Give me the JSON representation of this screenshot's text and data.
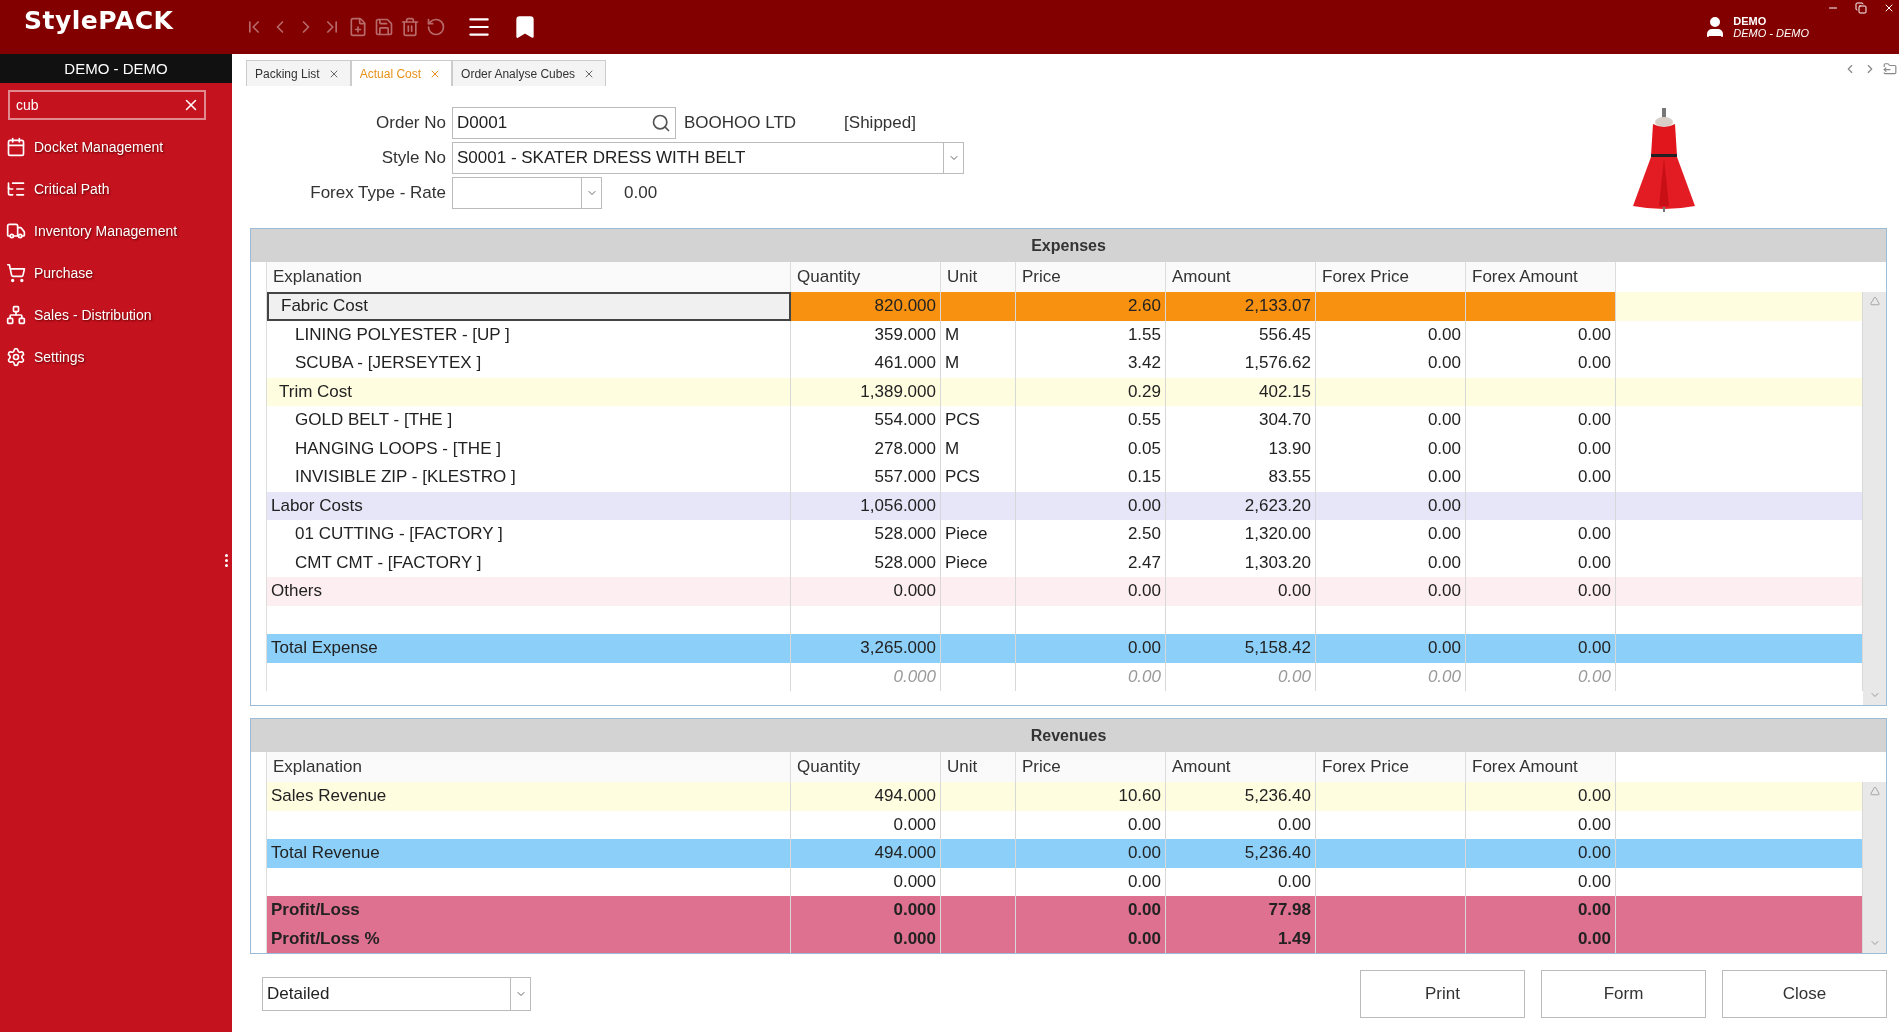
{
  "app": {
    "logo": "StylePACK",
    "user": {
      "name": "DEMO",
      "company": "DEMO - DEMO"
    }
  },
  "sidebar": {
    "title": "DEMO - DEMO",
    "search": {
      "value": "cub"
    },
    "items": [
      {
        "label": "Docket Management"
      },
      {
        "label": "Critical Path"
      },
      {
        "label": "Inventory Management"
      },
      {
        "label": "Purchase"
      },
      {
        "label": "Sales - Distribution"
      },
      {
        "label": "Settings"
      }
    ]
  },
  "tabs": [
    {
      "label": "Packing List",
      "selected": false
    },
    {
      "label": "Actual Cost",
      "selected": true
    },
    {
      "label": "Order Analyse Cubes",
      "selected": false
    }
  ],
  "form": {
    "order_no": {
      "label": "Order No",
      "value": "D0001",
      "customer": "BOOHOO LTD",
      "status": "[Shipped]"
    },
    "style_no": {
      "label": "Style No",
      "value": "S0001 - SKATER DRESS WITH BELT"
    },
    "forex": {
      "label": "Forex Type - Rate",
      "rate": "0.00"
    }
  },
  "expenses": {
    "title": "Expenses",
    "columns": [
      "Explanation",
      "Quantity",
      "Unit",
      "Price",
      "Amount",
      "Forex Price",
      "Forex Amount"
    ],
    "rows": [
      {
        "kind": "group",
        "selected": true,
        "color": "#fffde0",
        "explanation": "Fabric Cost",
        "quantity": "820.000",
        "price": "2.60",
        "amount": "2,133.07",
        "children": [
          {
            "kind": "item",
            "explanation": "LINING POLYESTER - [UP ]",
            "quantity": "359.000",
            "unit": "M",
            "price": "1.55",
            "amount": "556.45",
            "forex_price": "0.00",
            "forex_amount": "0.00"
          },
          {
            "kind": "item",
            "explanation": "SCUBA - [JERSEYTEX ]",
            "quantity": "461.000",
            "unit": "M",
            "price": "3.42",
            "amount": "1,576.62",
            "forex_price": "0.00",
            "forex_amount": "0.00"
          }
        ]
      },
      {
        "kind": "group",
        "selected": false,
        "color": "#fffde0",
        "explanation": "Trim Cost",
        "quantity": "1,389.000",
        "price": "0.29",
        "amount": "402.15",
        "children": [
          {
            "kind": "item",
            "explanation": "GOLD BELT - [THE ]",
            "quantity": "554.000",
            "unit": "PCS",
            "price": "0.55",
            "amount": "304.70",
            "forex_price": "0.00",
            "forex_amount": "0.00"
          },
          {
            "kind": "item",
            "explanation": "HANGING LOOPS - [THE ]",
            "quantity": "278.000",
            "unit": "M",
            "price": "0.05",
            "amount": "13.90",
            "forex_price": "0.00",
            "forex_amount": "0.00"
          },
          {
            "kind": "item",
            "explanation": "INVISIBLE ZIP - [KLESTRO ]",
            "quantity": "557.000",
            "unit": "PCS",
            "price": "0.15",
            "amount": "83.55",
            "forex_price": "0.00",
            "forex_amount": "0.00"
          }
        ]
      },
      {
        "kind": "category",
        "selected": false,
        "color": "#e6e6f8",
        "explanation": "Labor Costs",
        "quantity": "1,056.000",
        "price": "0.00",
        "amount": "2,623.20",
        "forex_price": "0.00",
        "children": [
          {
            "kind": "item",
            "explanation": "01  CUTTING - [FACTORY ]",
            "quantity": "528.000",
            "unit": "Piece",
            "price": "2.50",
            "amount": "1,320.00",
            "forex_price": "0.00",
            "forex_amount": "0.00"
          },
          {
            "kind": "item",
            "explanation": "CMT  CMT - [FACTORY ]",
            "quantity": "528.000",
            "unit": "Piece",
            "price": "2.47",
            "amount": "1,303.20",
            "forex_price": "0.00",
            "forex_amount": "0.00"
          }
        ]
      },
      {
        "kind": "category",
        "selected": false,
        "color": "#fdeef2",
        "explanation": "Others",
        "quantity": "0.000",
        "price": "0.00",
        "amount": "0.00",
        "forex_price": "0.00",
        "forex_amount": "0.00"
      },
      {
        "kind": "blank",
        "selected": false
      },
      {
        "kind": "total",
        "selected": false,
        "color": "#8ccff8",
        "explanation": "Total Expense",
        "quantity": "3,265.000",
        "price": "0.00",
        "amount": "5,158.42",
        "forex_price": "0.00",
        "forex_amount": "0.00"
      },
      {
        "kind": "hint",
        "selected": false,
        "quantity": "0.000",
        "price": "0.00",
        "amount": "0.00",
        "forex_price": "0.00",
        "forex_amount": "0.00"
      }
    ]
  },
  "revenues": {
    "title": "Revenues",
    "columns": [
      "Explanation",
      "Quantity",
      "Unit",
      "Price",
      "Amount",
      "Forex Price",
      "Forex Amount"
    ],
    "rows": [
      {
        "kind": "category",
        "selected": false,
        "color": "#fffde0",
        "explanation": "Sales Revenue",
        "quantity": "494.000",
        "price": "10.60",
        "amount": "5,236.40",
        "forex_amount": "0.00"
      },
      {
        "kind": "category",
        "selected": false,
        "quantity": "0.000",
        "price": "0.00",
        "amount": "0.00",
        "forex_amount": "0.00"
      },
      {
        "kind": "total",
        "selected": false,
        "color": "#8ccff8",
        "explanation": "Total Revenue",
        "quantity": "494.000",
        "price": "0.00",
        "amount": "5,236.40",
        "forex_amount": "0.00"
      },
      {
        "kind": "category",
        "selected": false,
        "quantity": "0.000",
        "price": "0.00",
        "amount": "0.00",
        "forex_amount": "0.00"
      },
      {
        "kind": "summary",
        "selected": false,
        "color": "#de7090",
        "explanation": "Profit/Loss",
        "quantity": "0.000",
        "price": "0.00",
        "amount": "77.98",
        "forex_amount": "0.00"
      },
      {
        "kind": "summary",
        "selected": false,
        "color": "#de7090",
        "explanation": "Profit/Loss %",
        "quantity": "0.000",
        "price": "0.00",
        "amount": "1.49",
        "forex_amount": "0.00"
      }
    ]
  },
  "footer": {
    "view": "Detailed",
    "buttons": [
      "Print",
      "Form",
      "Close"
    ]
  }
}
